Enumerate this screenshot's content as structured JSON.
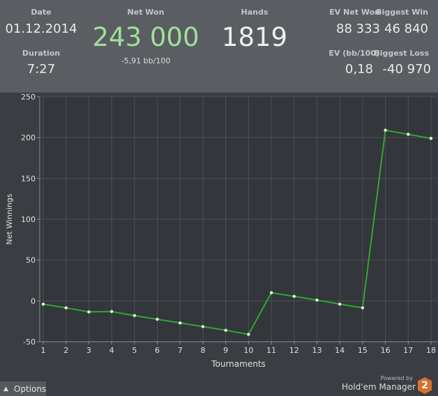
{
  "stats": {
    "date_label": "Date",
    "date_value": "01.12.2014",
    "duration_label": "Duration",
    "duration_value": "7:27",
    "net_won_label": "Net Won",
    "net_won_value": "243 000",
    "bb_per_100": "-5,91 bb/100",
    "hands_label": "Hands",
    "hands_value": "1819",
    "ev_net_won_label": "EV Net Won",
    "ev_net_won_value": "88 333",
    "ev_bb_label": "EV (bb/100)",
    "ev_bb_value": "0,18",
    "biggest_win_label": "Biggest Win",
    "biggest_win_value": "46 840",
    "biggest_loss_label": "Biggest Loss",
    "biggest_loss_value": "-40 970"
  },
  "chart_data": {
    "type": "line",
    "xlabel": "Tournaments",
    "ylabel": "Net Winnings",
    "x": [
      1,
      2,
      3,
      4,
      5,
      6,
      7,
      8,
      9,
      10,
      11,
      12,
      13,
      14,
      15,
      16,
      17,
      18
    ],
    "series": [
      {
        "values": [
          -4,
          -8.5,
          -13.5,
          -13,
          -18,
          -22.5,
          -27,
          -31.5,
          -36,
          -41,
          10,
          5.5,
          1,
          -4,
          -8.5,
          209,
          204,
          199
        ]
      }
    ],
    "xlim": [
      1,
      18
    ],
    "ylim": [
      -50,
      250
    ],
    "yticks": [
      -50,
      0,
      50,
      100,
      150,
      200,
      250
    ],
    "grid": true,
    "legend": "none",
    "line_color": "#2fa830",
    "marker_color": "#e6f5d9"
  },
  "footer": {
    "options_label": "Options",
    "powered_by": "Powered by",
    "brand_name": "Hold'em Manager",
    "brand_logo_text": "2"
  }
}
